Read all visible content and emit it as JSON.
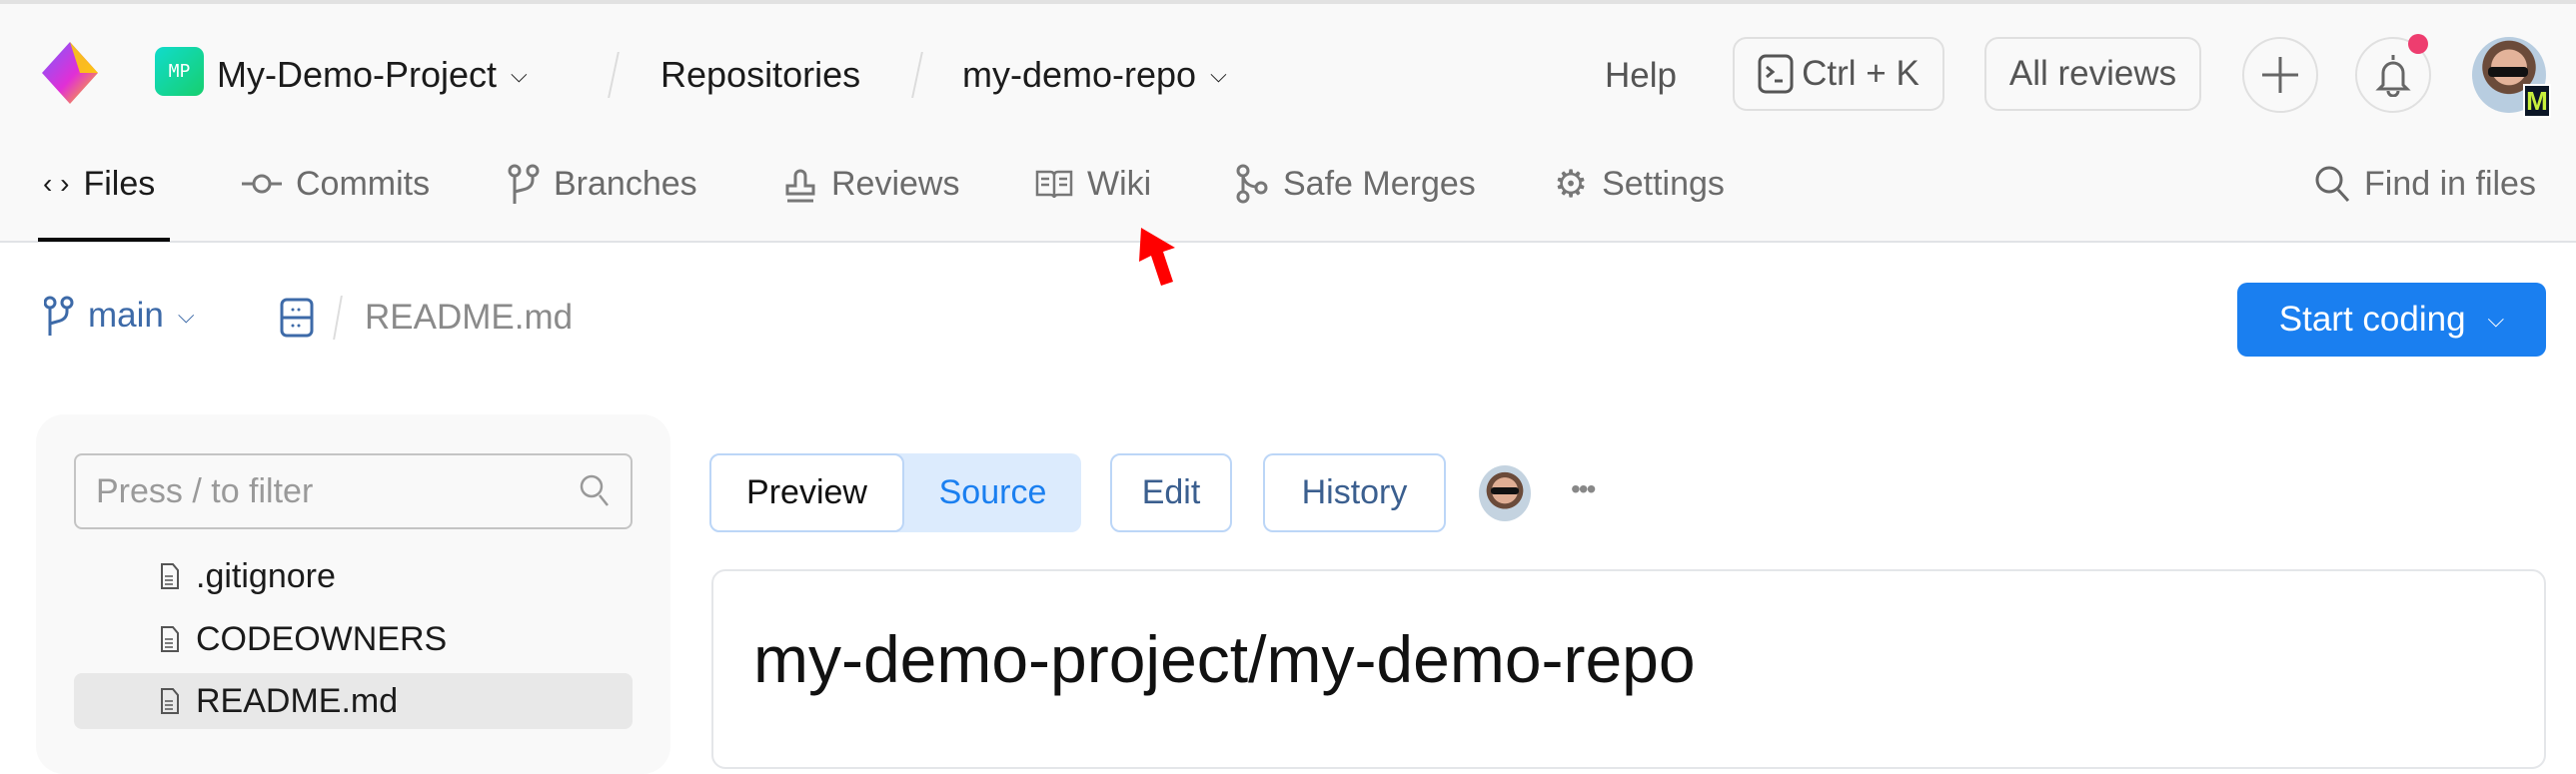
{
  "header": {
    "project_initials": "MP",
    "project_name": "My-Demo-Project",
    "section": "Repositories",
    "repo_name": "my-demo-repo",
    "help_label": "Help",
    "command_shortcut": "Ctrl + K",
    "all_reviews_label": "All reviews",
    "avatar_badge": "M"
  },
  "nav": {
    "tabs": [
      {
        "label": "Files",
        "icon": "code-icon",
        "active": true
      },
      {
        "label": "Commits",
        "icon": "commit-icon"
      },
      {
        "label": "Branches",
        "icon": "branch-icon"
      },
      {
        "label": "Reviews",
        "icon": "stamp-icon"
      },
      {
        "label": "Wiki",
        "icon": "book-icon"
      },
      {
        "label": "Safe Merges",
        "icon": "merge-icon"
      },
      {
        "label": "Settings",
        "icon": "gear-icon"
      }
    ],
    "find_in_files": "Find in files"
  },
  "toolbar": {
    "branch": "main",
    "file_path": "README.md",
    "start_coding_label": "Start coding"
  },
  "sidebar": {
    "filter_placeholder": "Press / to filter",
    "files": [
      {
        "name": ".gitignore"
      },
      {
        "name": "CODEOWNERS"
      },
      {
        "name": "README.md",
        "selected": true
      }
    ]
  },
  "viewer": {
    "preview_label": "Preview",
    "source_label": "Source",
    "edit_label": "Edit",
    "history_label": "History",
    "more_label": "•••",
    "title": "my-demo-project/my-demo-repo"
  },
  "colors": {
    "accent": "#1a7ff0",
    "notification": "#ee3d6f",
    "source_bg": "#dcebfd"
  }
}
